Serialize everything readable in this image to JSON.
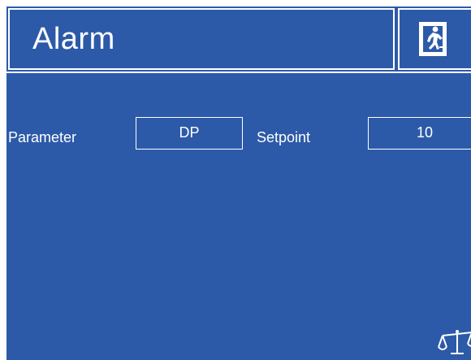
{
  "header": {
    "title": "Alarm",
    "exit_icon": "emergency-exit-icon"
  },
  "form": {
    "parameter_label": "Parameter",
    "parameter_value": "DP",
    "setpoint_label": "Setpoint",
    "setpoint_value": "10"
  },
  "footer": {
    "balance_icon": "balance-scale-icon"
  },
  "colors": {
    "background": "#2c5aa8",
    "foreground": "#ffffff"
  }
}
